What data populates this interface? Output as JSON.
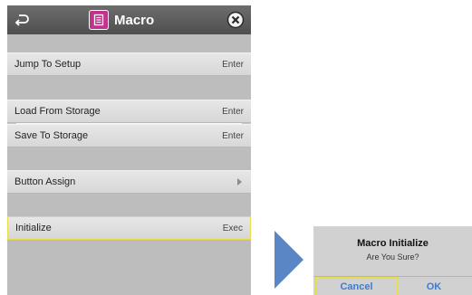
{
  "header": {
    "title": "Macro",
    "back_icon": "return-arrow-icon",
    "close_icon": "close-circle-icon",
    "app_icon": "macro-document-icon",
    "app_icon_color": "#c2338d"
  },
  "menu": {
    "jump_to_setup": {
      "label": "Jump To Setup",
      "value": "Enter"
    },
    "load_from_storage": {
      "label": "Load From Storage",
      "value": "Enter"
    },
    "save_to_storage": {
      "label": "Save To Storage",
      "value": "Enter"
    },
    "button_assign": {
      "label": "Button Assign",
      "value_icon": "chevron-right-icon"
    },
    "initialize": {
      "label": "Initialize",
      "value": "Exec"
    }
  },
  "dialog": {
    "title": "Macro Initialize",
    "message": "Are You Sure?",
    "cancel_label": "Cancel",
    "ok_label": "OK"
  },
  "colors": {
    "selection_highlight": "#e8dd4a",
    "dialog_button_text": "#3c7dd3",
    "transition_arrow": "#5a86c6"
  }
}
